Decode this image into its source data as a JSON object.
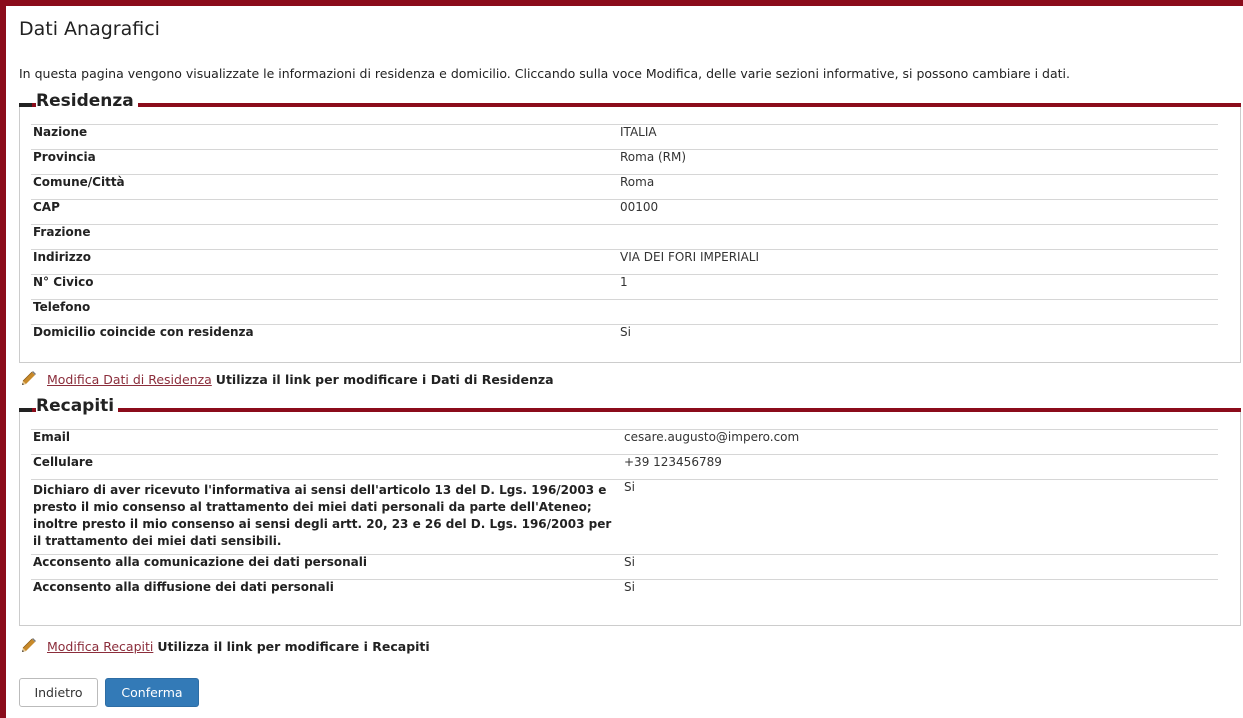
{
  "page": {
    "title": "Dati Anagrafici",
    "intro": "In questa pagina vengono visualizzate le informazioni di residenza e domicilio. Cliccando sulla voce Modifica, delle varie sezioni informative, si possono cambiare i dati."
  },
  "residenza": {
    "heading": "Residenza",
    "rows": [
      {
        "label": "Nazione",
        "value": "ITALIA"
      },
      {
        "label": "Provincia",
        "value": "Roma (RM)"
      },
      {
        "label": "Comune/Città",
        "value": "Roma"
      },
      {
        "label": "CAP",
        "value": "00100"
      },
      {
        "label": "Frazione",
        "value": ""
      },
      {
        "label": "Indirizzo",
        "value": "VIA DEI FORI IMPERIALI"
      },
      {
        "label": "N° Civico",
        "value": "1"
      },
      {
        "label": "Telefono",
        "value": ""
      },
      {
        "label": "Domicilio coincide con residenza",
        "value": "Si"
      }
    ],
    "edit_link": "Modifica Dati di Residenza",
    "edit_note": "Utilizza il link per modificare i Dati di Residenza"
  },
  "recapiti": {
    "heading": "Recapiti",
    "rows": [
      {
        "label": "Email",
        "value": "cesare.augusto@impero.com"
      },
      {
        "label": "Cellulare",
        "value": "+39 123456789"
      },
      {
        "label": "Dichiaro di aver ricevuto l'informativa ai sensi dell'articolo 13 del D. Lgs. 196/2003 e presto il mio consenso al trattamento dei miei dati personali da parte dell'Ateneo; inoltre presto il mio consenso ai sensi degli artt. 20, 23 e 26 del D. Lgs. 196/2003 per il trattamento dei miei dati sensibili.",
        "value": "Si"
      },
      {
        "label": "Acconsento alla comunicazione dei dati personali",
        "value": "Si"
      },
      {
        "label": "Acconsento alla diffusione dei dati personali",
        "value": "Si"
      }
    ],
    "edit_link": "Modifica Recapiti",
    "edit_note": "Utilizza il link per modificare i Recapiti"
  },
  "buttons": {
    "back": "Indietro",
    "confirm": "Conferma"
  },
  "colors": {
    "accent": "#8b0c1b",
    "primary_button": "#337ab7",
    "link": "#8b2d3b"
  }
}
